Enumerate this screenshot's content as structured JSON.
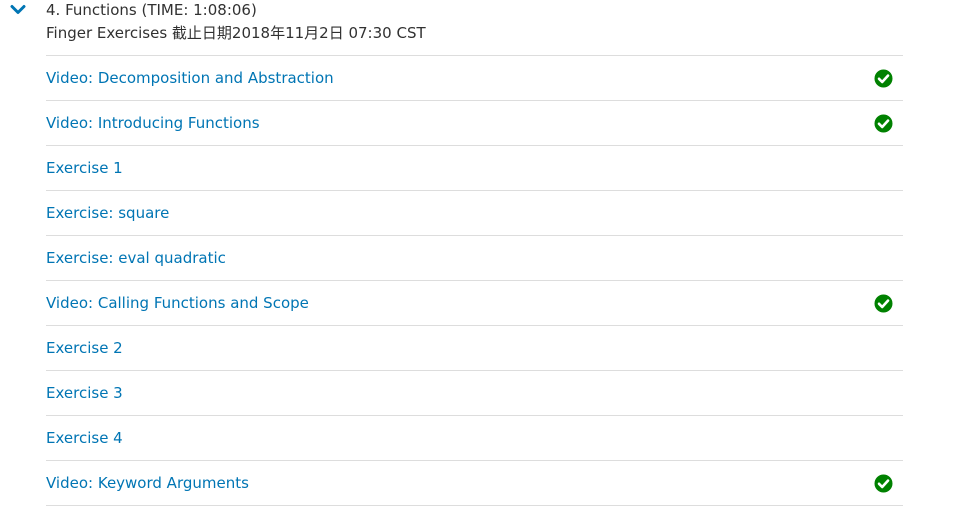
{
  "section": {
    "title": "4. Functions (TIME: 1:08:06)",
    "subtitle": "Finger Exercises 截止日期2018年11月2日 07:30 CST",
    "items": [
      {
        "label": "Video: Decomposition and Abstraction",
        "completed": true
      },
      {
        "label": "Video: Introducing Functions",
        "completed": true
      },
      {
        "label": "Exercise 1",
        "completed": false
      },
      {
        "label": "Exercise: square",
        "completed": false
      },
      {
        "label": "Exercise: eval quadratic",
        "completed": false
      },
      {
        "label": "Video: Calling Functions and Scope",
        "completed": true
      },
      {
        "label": "Exercise 2",
        "completed": false
      },
      {
        "label": "Exercise 3",
        "completed": false
      },
      {
        "label": "Exercise 4",
        "completed": false
      },
      {
        "label": "Video: Keyword Arguments",
        "completed": true
      }
    ]
  },
  "icons": {
    "toggle": "chevron-down-icon",
    "completed": "check-circle-icon"
  },
  "colors": {
    "link": "#0075b4",
    "chevron": "#0075b4",
    "text": "#313131",
    "check": "#008100",
    "divider": "#dddddd"
  }
}
